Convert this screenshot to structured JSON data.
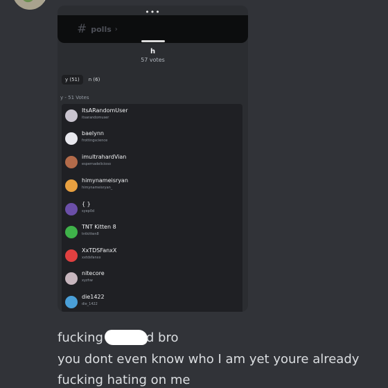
{
  "channel": {
    "name": "polls"
  },
  "poll": {
    "title": "h",
    "votes_label": "57 votes"
  },
  "tabs": [
    {
      "label": "y (51)",
      "active": true
    },
    {
      "label": "n (6)",
      "active": false
    }
  ],
  "answer_header": "y - 51 Votes",
  "voters": [
    {
      "display": "ItsARandomUser",
      "username": "itsarandomuser",
      "color": "#c9c4cf"
    },
    {
      "display": "baelynn",
      "username": "frottingscience",
      "color": "#e8e8ee"
    },
    {
      "display": "imultrahardVian",
      "username": "espernadelicioso",
      "color": "#b36b4a"
    },
    {
      "display": "himynameisryan",
      "username": "himynameisryan_",
      "color": "#e8a040"
    },
    {
      "display": "{ }",
      "username": "syep0d",
      "color": "#6b4fa8"
    },
    {
      "display": "TNT Kitten 8",
      "username": "tntkitten8",
      "color": "#3fb24a"
    },
    {
      "display": "XxTDSFanxX",
      "username": "xxtdsfanxx",
      "color": "#e04040"
    },
    {
      "display": "nitecore",
      "username": "xyzhw",
      "color": "#c7b6be"
    },
    {
      "display": "die1422",
      "username": "die_1422",
      "color": "#4a9fd8"
    }
  ],
  "messages": {
    "line1_before": "fucking",
    "line1_after": "d bro",
    "line2": "you dont even know who I am yet youre already",
    "line3": "fucking hating on me"
  }
}
